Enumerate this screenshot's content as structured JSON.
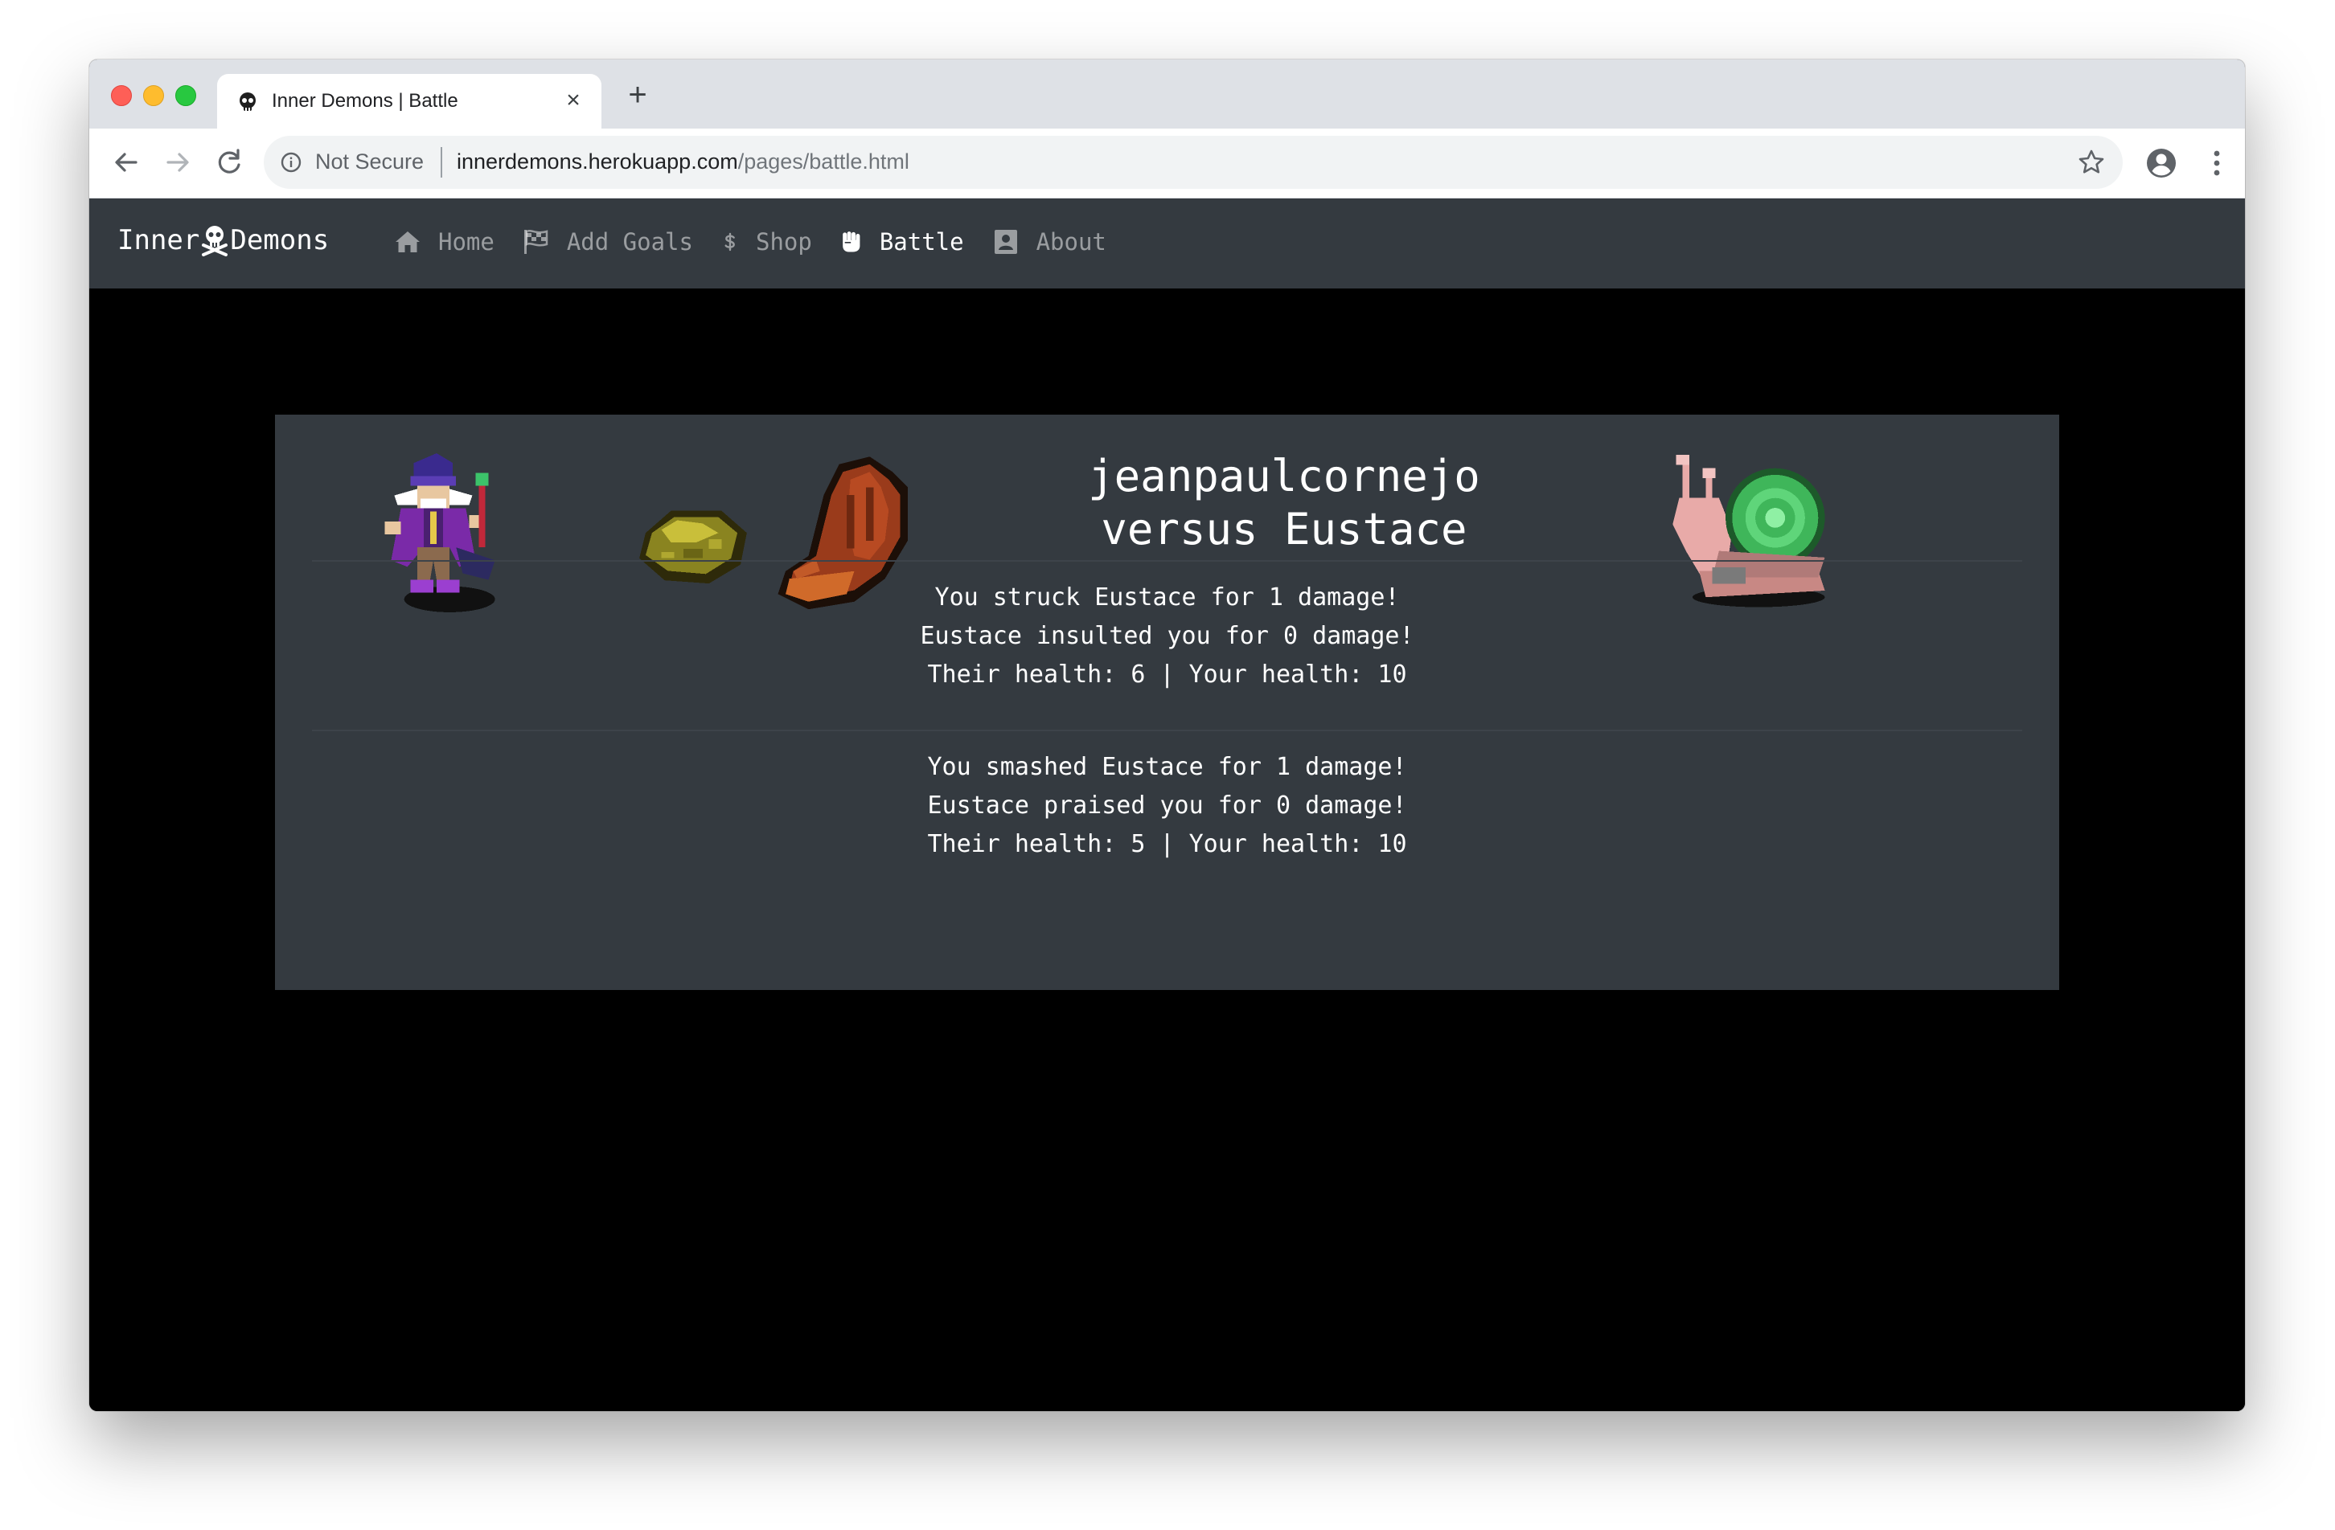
{
  "browser": {
    "tab_title": "Inner Demons | Battle",
    "tab_close": "×",
    "new_tab": "+",
    "security_label": "Not Secure",
    "url_domain": "innerdemons.herokuapp.com",
    "url_path": "/pages/battle.html"
  },
  "navbar": {
    "brand_left": "Inner",
    "brand_right": "Demons",
    "links": [
      {
        "label": "Home",
        "icon": "home-icon",
        "active": false
      },
      {
        "label": "Add Goals",
        "icon": "checkered-flag-icon",
        "active": false
      },
      {
        "label": "Shop",
        "icon": "dollar-icon",
        "active": false
      },
      {
        "label": "Battle",
        "icon": "fist-icon",
        "active": true
      },
      {
        "label": "About",
        "icon": "contact-card-icon",
        "active": false
      }
    ]
  },
  "battle": {
    "player_name": "jeanpaulcornejo",
    "versus_line": "versus Eustace",
    "player_sprite": "wizard-sprite",
    "items": [
      "gold-ore-item",
      "leather-glove-item"
    ],
    "enemy_sprite": "snail-sprite",
    "log": [
      {
        "action": "You struck Eustace for 1 damage!",
        "response": "Eustace insulted you for 0 damage!",
        "health": "Their health: 6 | Your health: 10"
      },
      {
        "action": "You smashed Eustace for 1 damage!",
        "response": "Eustace praised you for 0 damage!",
        "health": "Their health: 5 | Your health: 10"
      }
    ]
  },
  "colors": {
    "navbar_bg": "#343a40",
    "card_bg": "#343a40",
    "page_bg": "#000000",
    "link_inactive": "rgba(255,255,255,0.5)",
    "link_active": "#ffffff"
  }
}
